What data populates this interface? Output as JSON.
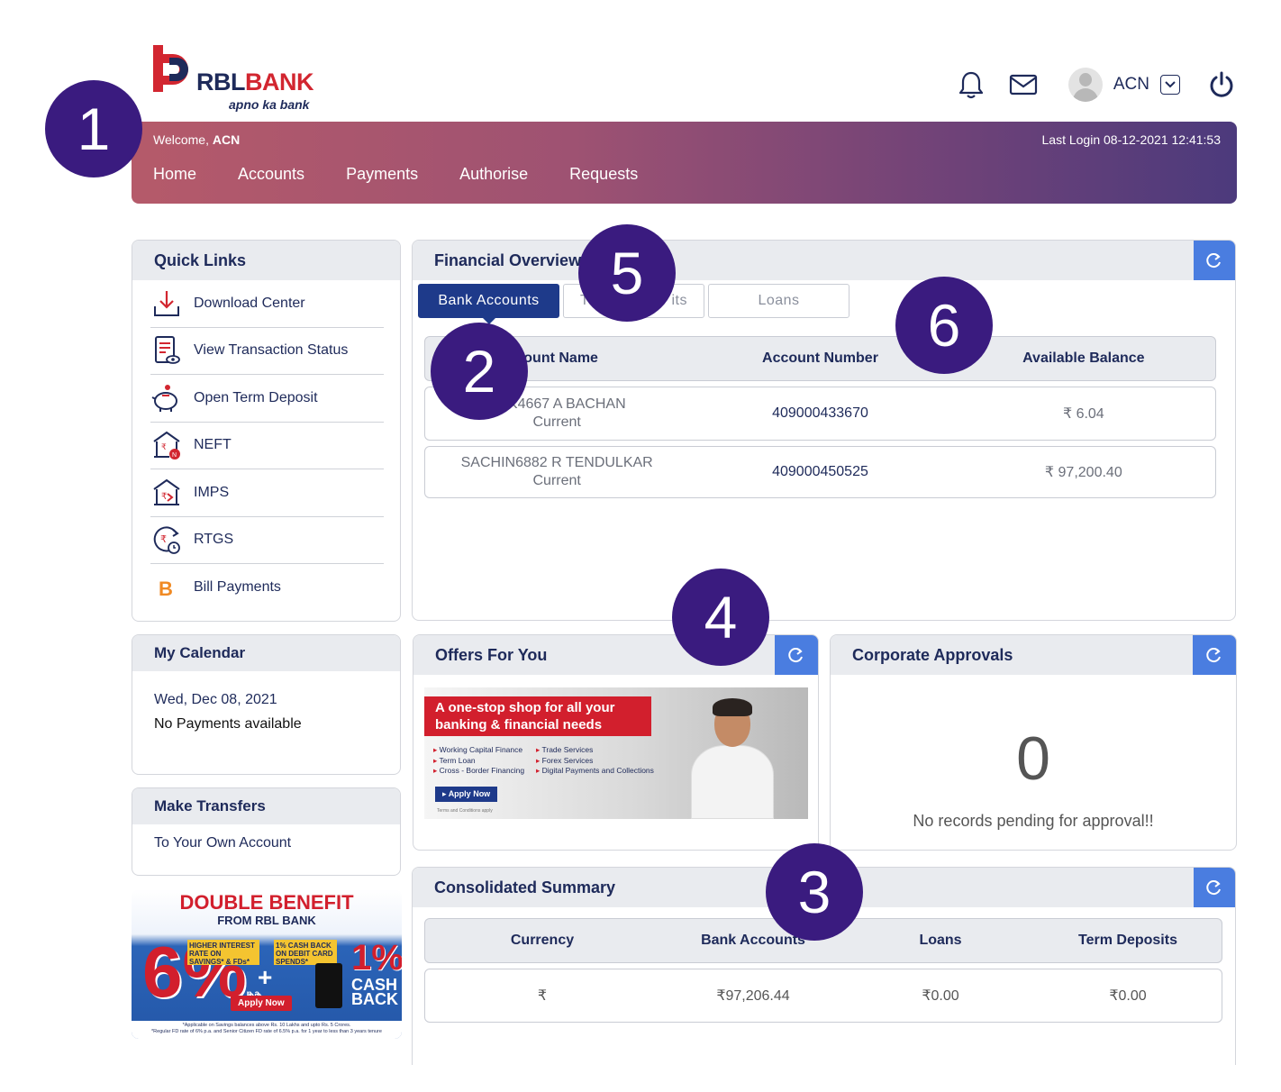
{
  "brand": {
    "name_part1": "RBL",
    "name_part2": "BANK",
    "tagline": "apno ka bank"
  },
  "header": {
    "user_name": "ACN",
    "icons": [
      "bell-icon",
      "mail-icon",
      "avatar",
      "chevron-down-icon",
      "power-icon"
    ]
  },
  "navbar": {
    "welcome_prefix": "Welcome,",
    "welcome_user": "ACN",
    "last_login": "Last Login 08-12-2021 12:41:53",
    "menu": [
      "Home",
      "Accounts",
      "Payments",
      "Authorise",
      "Requests"
    ]
  },
  "quick_links": {
    "title": "Quick Links",
    "items": [
      {
        "label": "Download Center",
        "icon": "download-icon"
      },
      {
        "label": "View Transaction Status",
        "icon": "transaction-status-icon"
      },
      {
        "label": "Open Term Deposit",
        "icon": "piggy-bank-icon"
      },
      {
        "label": "NEFT",
        "icon": "neft-icon"
      },
      {
        "label": "IMPS",
        "icon": "imps-icon"
      },
      {
        "label": "RTGS",
        "icon": "rtgs-icon"
      },
      {
        "label": "Bill Payments",
        "icon": "bill-payments-icon"
      }
    ]
  },
  "calendar": {
    "title": "My Calendar",
    "date": "Wed, Dec 08, 2021",
    "message": "No Payments available"
  },
  "make_transfers": {
    "title": "Make Transfers",
    "link": "To Your Own Account"
  },
  "promo": {
    "headline": "DOUBLE BENEFIT",
    "subhead": "FROM RBL BANK",
    "big_rate": "6%",
    "rate_suffix": "p.a.",
    "badge1": "HIGHER INTEREST RATE ON SAVINGS* & FDs*",
    "badge2": "1% CASH BACK ON DEBIT CARD SPENDS*",
    "cash_pct": "1%",
    "cash_label_1": "CASH",
    "cash_label_2": "BACK",
    "apply": "Apply Now",
    "fine_1": "*Applicable on Savings balances above Rs. 10 Lakhs and upto Rs. 5 Crores.",
    "fine_2": "*Regular FD rate of 6% p.a. and Senior Citizen FD rate of 6.5% p.a. for 1 year to less than 3 years tenure"
  },
  "financial_overview": {
    "title": "Financial Overview",
    "tabs": [
      "Bank Accounts",
      "T",
      "its",
      "Loans"
    ],
    "columns": [
      "count Name",
      "Account Number",
      "Available Balance"
    ],
    "rows": [
      {
        "name": "HEK4667 A BACHAN",
        "type": "Current",
        "number": "409000433670",
        "balance": "₹ 6.04"
      },
      {
        "name": "SACHIN6882 R TENDULKAR",
        "type": "Current",
        "number": "409000450525",
        "balance": "₹ 97,200.40"
      }
    ]
  },
  "offers": {
    "title": "Offers For You",
    "headline_1": "A one-stop shop for all your",
    "headline_2": "banking & financial needs",
    "list_left": [
      "Working Capital Finance",
      "Term Loan",
      "Cross - Border Financing"
    ],
    "list_right": [
      "Trade Services",
      "Forex Services",
      "Digital Payments and Collections"
    ],
    "apply": "Apply Now",
    "tc": "Terms and Conditions apply"
  },
  "corporate_approvals": {
    "title": "Corporate Approvals",
    "count": "0",
    "message": "No records pending for approval!!"
  },
  "consolidated_summary": {
    "title": "Consolidated Summary",
    "columns": [
      "Currency",
      "Bank Accounts",
      "Loans",
      "Term Deposits"
    ],
    "row": [
      "₹",
      "₹97,206.44",
      "₹0.00",
      "₹0.00"
    ]
  },
  "annotations": [
    "1",
    "2",
    "3",
    "4",
    "5",
    "6"
  ],
  "colors": {
    "brand_navy": "#1e2a5a",
    "brand_red": "#d22630",
    "refresh_blue": "#4a7de0",
    "annotation": "#3a1b7f",
    "tab_active": "#1e3a8a"
  }
}
